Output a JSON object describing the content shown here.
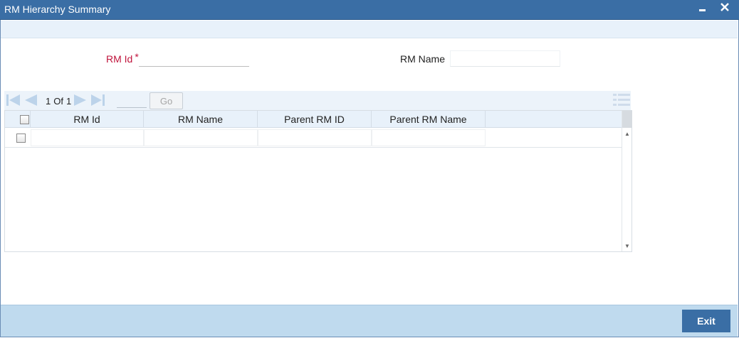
{
  "window": {
    "title": "RM Hierarchy Summary",
    "minimize_glyph": "▁",
    "close_glyph": "✕"
  },
  "search": {
    "rm_id_label": "RM Id",
    "required_marker": "*",
    "rm_id_value": "",
    "rm_name_label": "RM Name",
    "rm_name_value": ""
  },
  "pager": {
    "current_page": "1",
    "of_label": "Of",
    "total_pages": "1",
    "goto_value": "",
    "go_label": "Go",
    "icons": [
      "first-page-icon",
      "prev-page-icon",
      "next-page-icon",
      "last-page-icon",
      "list-view-icon"
    ]
  },
  "grid": {
    "columns": [
      "RM Id",
      "RM Name",
      "Parent RM ID",
      "Parent RM Name"
    ],
    "rows": [
      {
        "rm_id": "",
        "rm_name": "",
        "parent_rm_id": "",
        "parent_rm_name": ""
      }
    ]
  },
  "footer": {
    "exit_label": "Exit"
  },
  "colors": {
    "titlebar": "#3a6ea5",
    "accent_label": "#c0143c",
    "footer": "#bfdaee",
    "header_bg": "#e8f1fa"
  }
}
